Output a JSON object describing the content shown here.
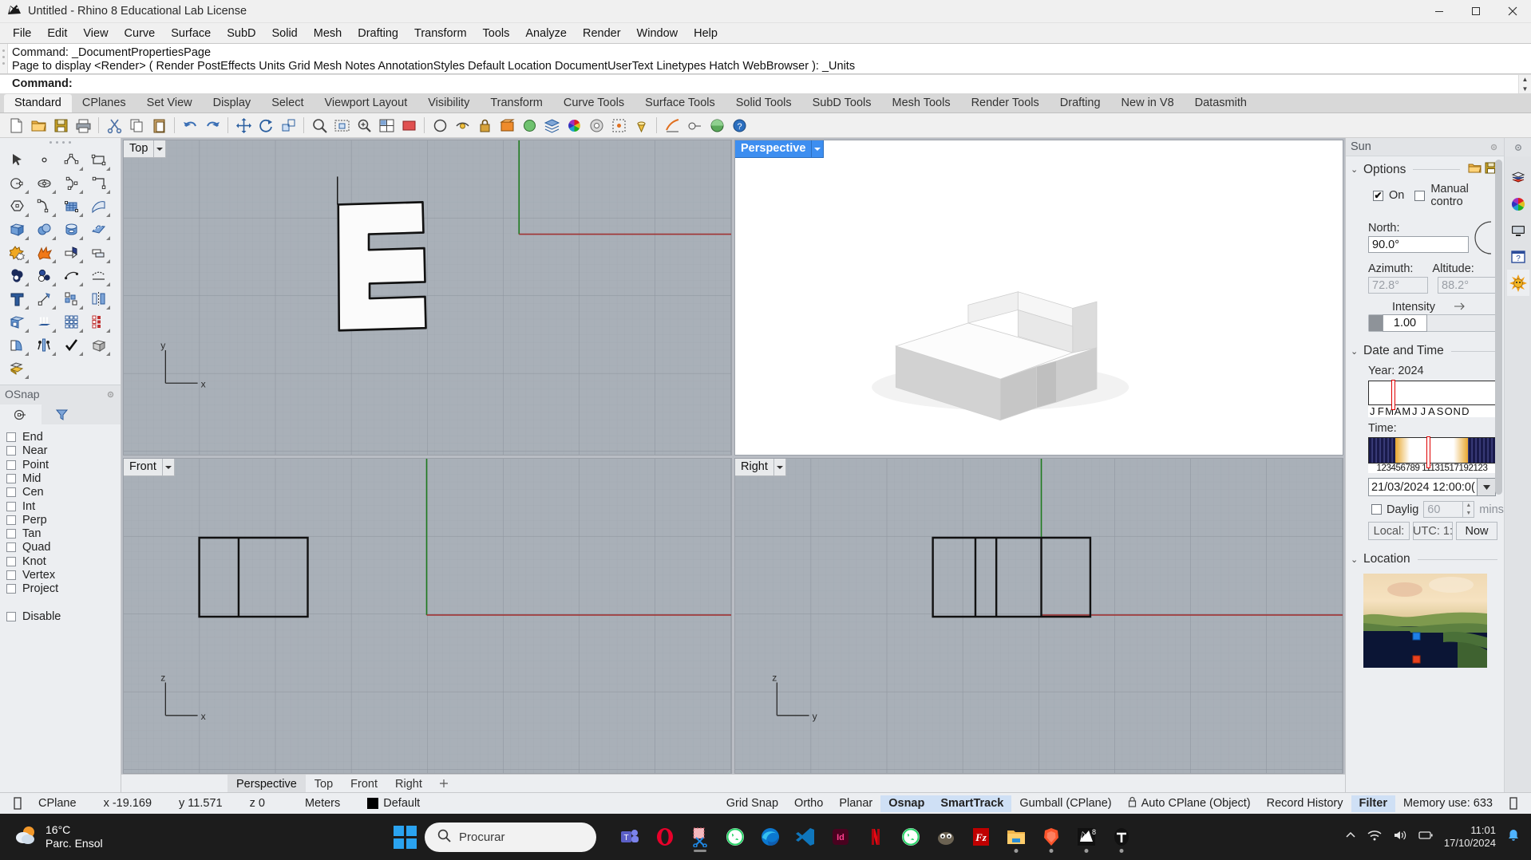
{
  "window": {
    "title": "Untitled - Rhino 8 Educational Lab License",
    "app_icon": "rhino-logo-icon",
    "minimize": "minimize-icon",
    "maximize": "maximize-icon",
    "close": "close-icon"
  },
  "menu": {
    "items": [
      "File",
      "Edit",
      "View",
      "Curve",
      "Surface",
      "SubD",
      "Solid",
      "Mesh",
      "Drafting",
      "Transform",
      "Tools",
      "Analyze",
      "Render",
      "Window",
      "Help"
    ]
  },
  "command_area": {
    "history": [
      "Command: _DocumentPropertiesPage",
      "Page to display <Render> ( Render  PostEffects  Units  Grid  Mesh  Notes  AnnotationStyles  Default  Location  DocumentUserText  Linetypes  Hatch  WebBrowser ): _Units"
    ],
    "prompt": "Command:",
    "input_value": ""
  },
  "toolbar_tabs": {
    "items": [
      "Standard",
      "CPlanes",
      "Set View",
      "Display",
      "Select",
      "Viewport Layout",
      "Visibility",
      "Transform",
      "Curve Tools",
      "Surface Tools",
      "Solid Tools",
      "SubD Tools",
      "Mesh Tools",
      "Render Tools",
      "Drafting",
      "New in V8",
      "Datasmith"
    ],
    "active": "Standard"
  },
  "toolbar_icons": [
    "new-file-icon",
    "open-folder-icon",
    "save-icon",
    "print-icon",
    "cut-icon",
    "copy-icon",
    "paste-icon",
    "undo-icon",
    "redo-icon",
    "move-icon",
    "rotate-icon",
    "scale-icon",
    "zoom-window-icon",
    "zoom-extents-icon",
    "zoom-selected-icon",
    "four-view-layout-icon",
    "shade-icon",
    "render-icon",
    "hide-objects-icon",
    "show-objects-icon",
    "lock-objects-icon",
    "group-icon",
    "ungroup-icon",
    "layers-icon",
    "color-wheel-icon",
    "properties-icon",
    "object-snap-icon",
    "point-light-icon",
    "analyze-icon",
    "curvature-icon",
    "render-tools-icon",
    "help-icon"
  ],
  "left_palette": {
    "grip": "drag-grip",
    "icons": [
      "select-arrow-icon",
      "point-icon",
      "polyline-icon",
      "rectangle-icon",
      "circle-icon",
      "ellipse-icon",
      "arc-icon",
      "curve-box-icon",
      "polygon-icon",
      "fillet-curve-icon",
      "surface-from-network-icon",
      "surface-sweep-icon",
      "box-icon",
      "sphere-icon",
      "cylinder-icon",
      "extrude-surface-icon",
      "boolean-union-icon",
      "explode-icon",
      "cap-planar-holes-icon",
      "offset-surface-icon",
      "boolean-difference-icon",
      "boolean-split-icon",
      "blend-curve-icon",
      "project-curve-icon",
      "text-icon",
      "scale-icon",
      "array-icon",
      "mirror-icon",
      "box-edit-icon",
      "extrude-curve-icon",
      "array-grid-icon",
      "array-polar-icon",
      "unroll-surface-icon",
      "flow-along-curve-icon",
      "check-objects-icon",
      "mesh-from-surface-icon",
      "paint-bucket-icon"
    ]
  },
  "osnap": {
    "title": "OSnap",
    "gear": "gear-icon",
    "tabs": [
      "osnap-tab-icon",
      "filter-tab-icon"
    ],
    "active_tab": 0,
    "options": [
      {
        "label": "End",
        "checked": false
      },
      {
        "label": "Near",
        "checked": false
      },
      {
        "label": "Point",
        "checked": false
      },
      {
        "label": "Mid",
        "checked": false
      },
      {
        "label": "Cen",
        "checked": false
      },
      {
        "label": "Int",
        "checked": false
      },
      {
        "label": "Perp",
        "checked": false
      },
      {
        "label": "Tan",
        "checked": false
      },
      {
        "label": "Quad",
        "checked": false
      },
      {
        "label": "Knot",
        "checked": false
      },
      {
        "label": "Vertex",
        "checked": false
      },
      {
        "label": "Project",
        "checked": false
      }
    ],
    "disable": {
      "label": "Disable",
      "checked": false
    }
  },
  "viewports": [
    {
      "name": "Top",
      "active": false,
      "axis_x_label": "x",
      "axis_y_label": "y"
    },
    {
      "name": "Perspective",
      "active": true,
      "axis_x_label": "",
      "axis_y_label": ""
    },
    {
      "name": "Front",
      "active": false,
      "axis_x_label": "x",
      "axis_y_label": "z"
    },
    {
      "name": "Right",
      "active": false,
      "axis_x_label": "y",
      "axis_y_label": "z"
    }
  ],
  "viewport_tabs": {
    "items": [
      "Perspective",
      "Top",
      "Front",
      "Right"
    ],
    "active": "Perspective",
    "add": "add-viewport-icon"
  },
  "sun_panel": {
    "title": "Sun",
    "gear": "gear-icon",
    "options": {
      "header": "Options",
      "load_icon": "open-folder-icon",
      "save_icon": "save-icon",
      "on": {
        "label": "On",
        "checked": true
      },
      "manual_control": {
        "label": "Manual contro",
        "checked": false
      },
      "north": {
        "label": "North:",
        "value": "90.0°"
      },
      "azimuth": {
        "label": "Azimuth:",
        "value": "72.8°"
      },
      "altitude": {
        "label": "Altitude:",
        "value": "88.2°"
      },
      "intensity": {
        "label": "Intensity",
        "value": "1.00"
      }
    },
    "date_time": {
      "header": "Date and Time",
      "year_label": "Year: 2024",
      "months": [
        "J",
        "F",
        "M",
        "A",
        "M",
        "J",
        "J",
        "A",
        "S",
        "O",
        "N",
        "D"
      ],
      "month_marker_pct": 19,
      "time_label": "Time:",
      "hour_ticks": "123456789 11131517192123",
      "time_marker_pct": 47,
      "datetime_value": "21/03/2024 12:00:0(",
      "dropdown_icon": "chevron-down-icon",
      "daylight": {
        "label": "Daylig",
        "checked": false,
        "value": "60",
        "unit": "mins"
      },
      "local_btn": "Local: ",
      "utc_btn": "UTC: 1:",
      "now_btn": "Now"
    },
    "location": {
      "header": "Location",
      "map": "world-map-thumbnail",
      "marker_blue": "observer-marker",
      "marker_red": "sun-position-marker"
    }
  },
  "right_rail": {
    "gear": "gear-icon",
    "icons": [
      "layers-icon",
      "material-color-wheel-icon",
      "display-monitor-icon",
      "help-question-icon",
      "sun-icon"
    ],
    "selected": "sun-icon"
  },
  "status_bar": {
    "lock_icon": "cplane-lock-icon",
    "cplane": "CPlane",
    "x": "x -19.169",
    "y": "y 11.571",
    "z": "z 0",
    "units": "Meters",
    "layer_swatch": "#000000",
    "layer": "Default",
    "toggles": [
      {
        "label": "Grid Snap",
        "on": false
      },
      {
        "label": "Ortho",
        "on": false
      },
      {
        "label": "Planar",
        "on": false
      },
      {
        "label": "Osnap",
        "on": true
      },
      {
        "label": "SmartTrack",
        "on": true
      },
      {
        "label": "Gumball (CPlane)",
        "on": false
      },
      {
        "label": "Auto CPlane (Object)",
        "on": false,
        "icon": "padlock-icon"
      },
      {
        "label": "Record History",
        "on": false
      },
      {
        "label": "Filter",
        "on": true
      }
    ],
    "memory": "Memory use: 633",
    "end_icon": "panel-toggle-icon"
  },
  "taskbar": {
    "weather": {
      "icon": "partly-cloudy-icon",
      "temp": "16°C",
      "desc": "Parc. Ensol"
    },
    "start": "windows-start-icon",
    "search": {
      "icon": "search-icon",
      "placeholder": "Procurar"
    },
    "apps": [
      {
        "name": "microsoft-teams-icon",
        "running": false
      },
      {
        "name": "opera-icon",
        "running": false
      },
      {
        "name": "snipping-tool-icon",
        "running": true
      },
      {
        "name": "whatsapp-icon",
        "running": false
      },
      {
        "name": "microsoft-edge-icon",
        "running": false
      },
      {
        "name": "vs-code-icon",
        "running": false
      },
      {
        "name": "indesign-icon",
        "running": false
      },
      {
        "name": "netflix-icon",
        "running": false
      },
      {
        "name": "whatsapp-2-icon",
        "running": false
      },
      {
        "name": "gimp-icon",
        "running": false
      },
      {
        "name": "filezilla-icon",
        "running": false
      },
      {
        "name": "file-explorer-icon",
        "running": true
      },
      {
        "name": "brave-browser-icon",
        "running": true
      },
      {
        "name": "rhino-8-icon",
        "running": true
      },
      {
        "name": "twinmotion-icon",
        "running": true
      }
    ],
    "tray": {
      "chevron": "show-hidden-icons-icon",
      "wifi": "wifi-icon",
      "volume": "volume-icon",
      "battery": "battery-icon",
      "time": "11:01",
      "date": "17/10/2024",
      "notification": "notification-bell-icon"
    }
  },
  "colors": {
    "accent": "#3d8ef0",
    "viewport_bg": "#a9b0b8",
    "axis_green": "#1f7a1f",
    "axis_red": "#a03333",
    "status_highlight": "#cfe0f5"
  }
}
